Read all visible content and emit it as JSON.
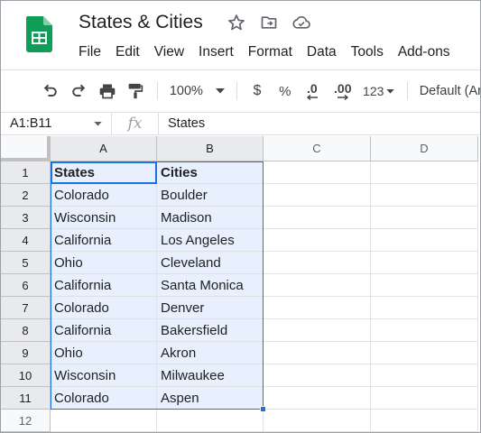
{
  "document": {
    "title": "States & Cities",
    "star_icon": "star-icon",
    "move_icon": "move-to-folder-icon",
    "cloud_icon": "cloud-saved-icon",
    "logo_icon": "sheets-logo-icon"
  },
  "menu": [
    "File",
    "Edit",
    "View",
    "Insert",
    "Format",
    "Data",
    "Tools",
    "Add-ons"
  ],
  "toolbar": {
    "zoom": "100%",
    "currency": "$",
    "percent": "%",
    "decrease_decimal": ".0",
    "increase_decimal": ".00",
    "more_formats": "123",
    "font": "Default (Ar"
  },
  "formula_bar": {
    "name_box": "A1:B11",
    "fx": "fx",
    "value": "States"
  },
  "columns": [
    "A",
    "B",
    "C",
    "D"
  ],
  "rows": [
    "1",
    "2",
    "3",
    "4",
    "5",
    "6",
    "7",
    "8",
    "9",
    "10",
    "11",
    "12"
  ],
  "cells": [
    [
      "States",
      "Cities"
    ],
    [
      "Colorado",
      "Boulder"
    ],
    [
      "Wisconsin",
      "Madison"
    ],
    [
      "California",
      "Los Angeles"
    ],
    [
      "Ohio",
      "Cleveland"
    ],
    [
      "California",
      "Santa Monica"
    ],
    [
      "Colorado",
      "Denver"
    ],
    [
      "California",
      "Bakersfield"
    ],
    [
      "Ohio",
      "Akron"
    ],
    [
      "Wisconsin",
      "Milwaukee"
    ],
    [
      "Colorado",
      "Aspen"
    ]
  ],
  "colors": {
    "accent": "#1a73e8",
    "selection_fill": "#e8f0fe",
    "sheets_green": "#0f9d58"
  }
}
